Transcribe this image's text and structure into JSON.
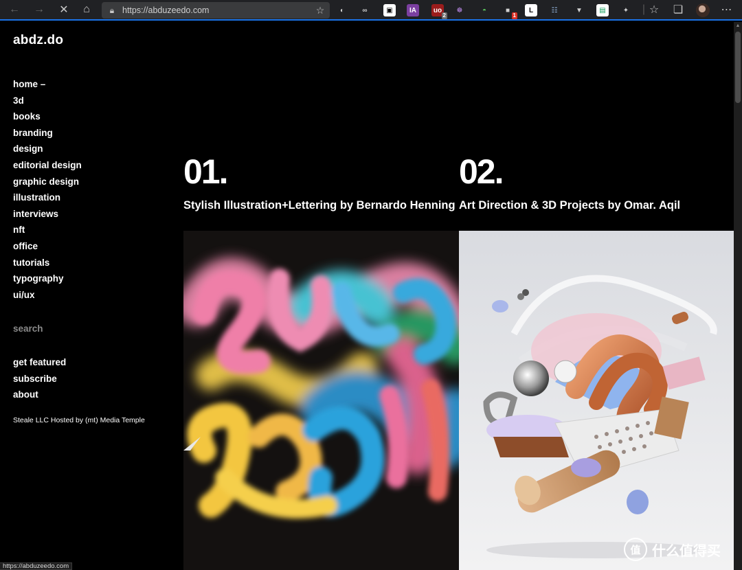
{
  "browser": {
    "url": "https://abduzeedo.com",
    "status_url": "https://abduzeedo.com",
    "extensions": [
      {
        "name": "shield-ext-icon",
        "glyph": "◐",
        "color": "#d0d0d0",
        "bg": "#202124"
      },
      {
        "name": "glasses-ext-icon",
        "glyph": "∞",
        "color": "#d0d0d0",
        "bg": "#202124"
      },
      {
        "name": "camera-ext-icon",
        "glyph": "▣",
        "color": "#000000",
        "bg": "#ffffff"
      },
      {
        "name": "ia-ext-icon",
        "glyph": "IA",
        "color": "#ffffff",
        "bg": "#7b3fa0"
      },
      {
        "name": "ublock-ext-icon",
        "glyph": "uo",
        "color": "#ffffff",
        "bg": "#9b1c1c",
        "badge": "2"
      },
      {
        "name": "cat-ext-icon",
        "glyph": "☸",
        "color": "#c18cf0",
        "bg": "#202124"
      },
      {
        "name": "leaf-ext-icon",
        "glyph": "◓",
        "color": "#58c05a",
        "bg": "#202124"
      },
      {
        "name": "game-ext-icon",
        "glyph": "■",
        "color": "#d0d0d0",
        "bg": "#202124",
        "badge": "1"
      },
      {
        "name": "bookmark-ext-icon",
        "glyph": "L",
        "color": "#000000",
        "bg": "#ffffff"
      },
      {
        "name": "translate-ext-icon",
        "glyph": "☷",
        "color": "#9fc5f0",
        "bg": "#202124"
      },
      {
        "name": "badge-ext-icon",
        "glyph": "▼",
        "color": "#d0d0d0",
        "bg": "#202124"
      },
      {
        "name": "sheet-ext-icon",
        "glyph": "▤",
        "color": "#0f9d58",
        "bg": "#ffffff"
      },
      {
        "name": "puzzle-ext-icon",
        "glyph": "✦",
        "color": "#d0d0d0",
        "bg": "#202124"
      }
    ]
  },
  "site": {
    "logo": "abdz.do",
    "menu": [
      "home –",
      "3d",
      "books",
      "branding",
      "design",
      "editorial design",
      "graphic design",
      "illustration",
      "interviews",
      "nft",
      "office",
      "tutorials",
      "typography",
      "ui/ux"
    ],
    "search_label": "search",
    "links": [
      "get featured",
      "subscribe",
      "about"
    ],
    "credit": "Steale LLC Hosted by (mt) Media Temple"
  },
  "articles": [
    {
      "number": "01.",
      "title": "Stylish Illustration+Lettering by Bernardo Henning"
    },
    {
      "number": "02.",
      "title": "Art Direction & 3D Projects by Omar. Aqil"
    }
  ],
  "watermark": {
    "mark": "值",
    "text": "什么值得买"
  },
  "colors": {
    "background": "#000000",
    "accent": "#1a73e8",
    "text": "#ffffff"
  }
}
